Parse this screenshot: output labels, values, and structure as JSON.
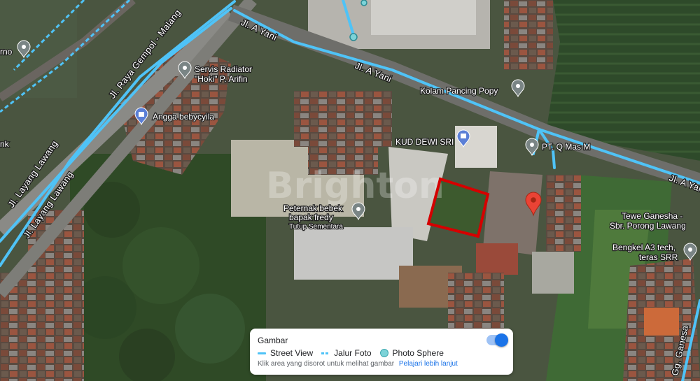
{
  "map": {
    "roads": {
      "jl_a_yani_1": "Jl. A Yani",
      "jl_a_yani_2": "Jl. A Yani",
      "jl_a_yani_3": "Jl. A Yani",
      "jl_raya_gempol": "Jl. Raya Gempol - Malang",
      "jl_layang_1": "Jl. Layang Lawang",
      "jl_layang_2": "Jl. Layang Lawang",
      "gg_ganesa": "Gg. Ganesa"
    },
    "places": {
      "rno": "rno",
      "nk": "nk",
      "servis_1": "Servis Radiator",
      "servis_2": "\"Hoki\" P. Arifin",
      "angga": "Angga bebycyila",
      "kolam": "Kolam Pancing Popy",
      "kud": "KUD DEWI SRI",
      "pt_qmas": "PT. Q Mas M",
      "peternak_1": "Peternak bebek",
      "peternak_2": "bapak fredy",
      "peternak_status": "Tutup Sementara",
      "tewe_1": "Tewe Ganesha -",
      "tewe_2": "Sbr. Porong Lawang",
      "bengkel_1": "Bengkel A3 tech,",
      "bengkel_2": "teras SRR"
    },
    "watermark": "Brighton",
    "colors": {
      "street_view": "#4fc3f7",
      "highlight": "#d50000",
      "pin": "#ea4335"
    }
  },
  "legend": {
    "title": "Gambar",
    "street_view": "Street View",
    "jalur_foto": "Jalur Foto",
    "photo_sphere": "Photo Sphere",
    "hint": "Klik area yang disorot untuk melihat gambar",
    "learn_more": "Pelajari lebih lanjut",
    "toggle_on": true
  }
}
